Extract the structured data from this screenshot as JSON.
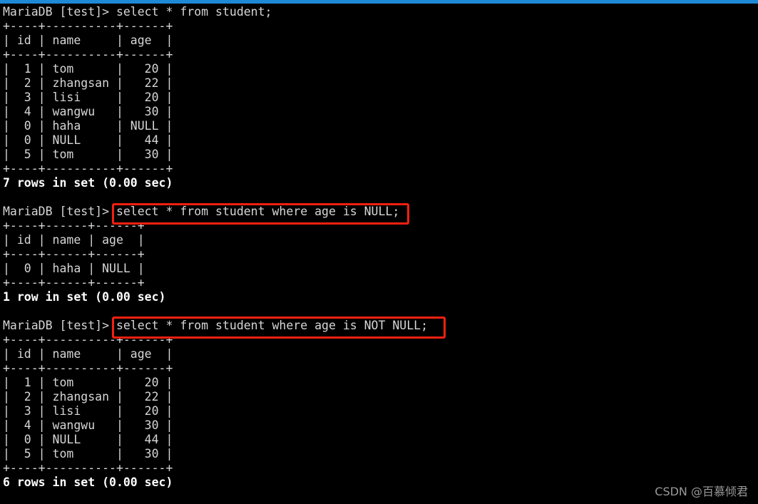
{
  "terminal": {
    "prompt": "MariaDB [test]> ",
    "background_color": "#000000",
    "text_color": "#d6d6d6",
    "bold_text_color": "#ffffff",
    "topbar_color": "#1e8ad6",
    "highlight_color": "#f52010"
  },
  "watermark": {
    "text": "CSDN @百慕倾君",
    "color": "#9a9a9a"
  },
  "lines": [
    {
      "text": "MariaDB [test]> select * from student;",
      "bold": false
    },
    {
      "text": "+----+----------+------+",
      "bold": false
    },
    {
      "text": "| id | name     | age  |",
      "bold": false
    },
    {
      "text": "+----+----------+------+",
      "bold": false
    },
    {
      "text": "|  1 | tom      |   20 |",
      "bold": false
    },
    {
      "text": "|  2 | zhangsan |   22 |",
      "bold": false
    },
    {
      "text": "|  3 | lisi     |   20 |",
      "bold": false
    },
    {
      "text": "|  4 | wangwu   |   30 |",
      "bold": false
    },
    {
      "text": "|  0 | haha     | NULL |",
      "bold": false
    },
    {
      "text": "|  0 | NULL     |   44 |",
      "bold": false
    },
    {
      "text": "|  5 | tom      |   30 |",
      "bold": false
    },
    {
      "text": "+----+----------+------+",
      "bold": false
    },
    {
      "text": "7 rows in set (0.00 sec)",
      "bold": true
    },
    {
      "text": "",
      "bold": false
    },
    {
      "text": "MariaDB [test]> select * from student where age is NULL;",
      "bold": false
    },
    {
      "text": "+----+------+------+",
      "bold": false
    },
    {
      "text": "| id | name | age  |",
      "bold": false
    },
    {
      "text": "+----+------+------+",
      "bold": false
    },
    {
      "text": "|  0 | haha | NULL |",
      "bold": false
    },
    {
      "text": "+----+------+------+",
      "bold": false
    },
    {
      "text": "1 row in set (0.00 sec)",
      "bold": true
    },
    {
      "text": "",
      "bold": false
    },
    {
      "text": "MariaDB [test]> select * from student where age is NOT NULL;",
      "bold": false
    },
    {
      "text": "+----+----------+------+",
      "bold": false
    },
    {
      "text": "| id | name     | age  |",
      "bold": false
    },
    {
      "text": "+----+----------+------+",
      "bold": false
    },
    {
      "text": "|  1 | tom      |   20 |",
      "bold": false
    },
    {
      "text": "|  2 | zhangsan |   22 |",
      "bold": false
    },
    {
      "text": "|  3 | lisi     |   20 |",
      "bold": false
    },
    {
      "text": "|  4 | wangwu   |   30 |",
      "bold": false
    },
    {
      "text": "|  0 | NULL     |   44 |",
      "bold": false
    },
    {
      "text": "|  5 | tom      |   30 |",
      "bold": false
    },
    {
      "text": "+----+----------+------+",
      "bold": false
    },
    {
      "text": "6 rows in set (0.00 sec)",
      "bold": true
    }
  ],
  "queries": [
    {
      "id": "query-select-all",
      "sql": "select * from student;",
      "highlighted": false,
      "result_rows_label": "7 rows in set (0.00 sec)"
    },
    {
      "id": "query-age-is-null",
      "sql": "select * from student where age is NULL;",
      "highlighted": true,
      "result_rows_label": "1 row in set (0.00 sec)"
    },
    {
      "id": "query-age-is-not-null",
      "sql": "select * from student where age is NOT NULL;",
      "highlighted": true,
      "result_rows_label": "6 rows in set (0.00 sec)"
    }
  ],
  "tables": [
    {
      "id": "result-table-all",
      "columns": [
        "id",
        "name",
        "age"
      ],
      "rows": [
        [
          "1",
          "tom",
          "20"
        ],
        [
          "2",
          "zhangsan",
          "22"
        ],
        [
          "3",
          "lisi",
          "20"
        ],
        [
          "4",
          "wangwu",
          "30"
        ],
        [
          "0",
          "haha",
          "NULL"
        ],
        [
          "0",
          "NULL",
          "44"
        ],
        [
          "5",
          "tom",
          "30"
        ]
      ]
    },
    {
      "id": "result-table-age-is-null",
      "columns": [
        "id",
        "name",
        "age"
      ],
      "rows": [
        [
          "0",
          "haha",
          "NULL"
        ]
      ]
    },
    {
      "id": "result-table-age-is-not-null",
      "columns": [
        "id",
        "name",
        "age"
      ],
      "rows": [
        [
          "1",
          "tom",
          "20"
        ],
        [
          "2",
          "zhangsan",
          "22"
        ],
        [
          "3",
          "lisi",
          "20"
        ],
        [
          "4",
          "wangwu",
          "30"
        ],
        [
          "0",
          "NULL",
          "44"
        ],
        [
          "5",
          "tom",
          "30"
        ]
      ]
    }
  ]
}
